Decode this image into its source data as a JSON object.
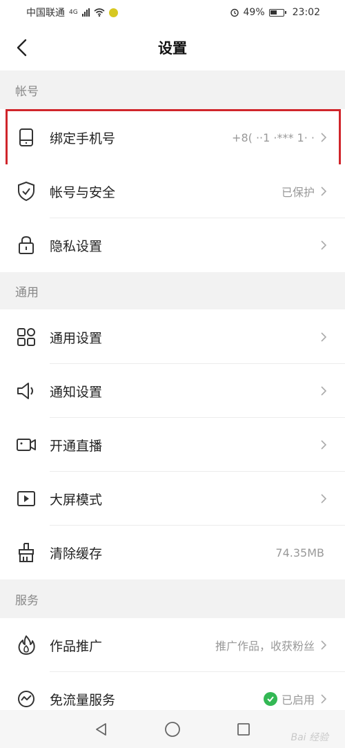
{
  "status_bar": {
    "carrier": "中国联通",
    "network": "4G",
    "alarm_icon": "alarm-icon",
    "battery_pct": "49%",
    "time": "23:02"
  },
  "header": {
    "title": "设置",
    "back_icon": "chevron-left-icon"
  },
  "sections": {
    "account": {
      "title": "帐号",
      "items": [
        {
          "icon": "phone-icon",
          "label": "绑定手机号",
          "value": "+8( ··1 ·*** 1· ·"
        },
        {
          "icon": "shield-check-icon",
          "label": "帐号与安全",
          "value": "已保护"
        },
        {
          "icon": "lock-icon",
          "label": "隐私设置",
          "value": ""
        }
      ]
    },
    "general": {
      "title": "通用",
      "items": [
        {
          "icon": "grid-icon",
          "label": "通用设置",
          "value": ""
        },
        {
          "icon": "speaker-icon",
          "label": "通知设置",
          "value": ""
        },
        {
          "icon": "video-camera-icon",
          "label": "开通直播",
          "value": ""
        },
        {
          "icon": "play-screen-icon",
          "label": "大屏模式",
          "value": ""
        },
        {
          "icon": "broom-icon",
          "label": "清除缓存",
          "value": "74.35MB"
        }
      ]
    },
    "services": {
      "title": "服务",
      "items": [
        {
          "icon": "flame-icon",
          "label": "作品推广",
          "value": "推广作品，收获粉丝"
        },
        {
          "icon": "free-data-icon",
          "label": "免流量服务",
          "value": "已启用"
        }
      ]
    }
  },
  "watermark": "Bai 经验",
  "colors": {
    "highlight": "#d0252b",
    "enabled": "#33b854",
    "section_bg": "#f2f2f2"
  }
}
